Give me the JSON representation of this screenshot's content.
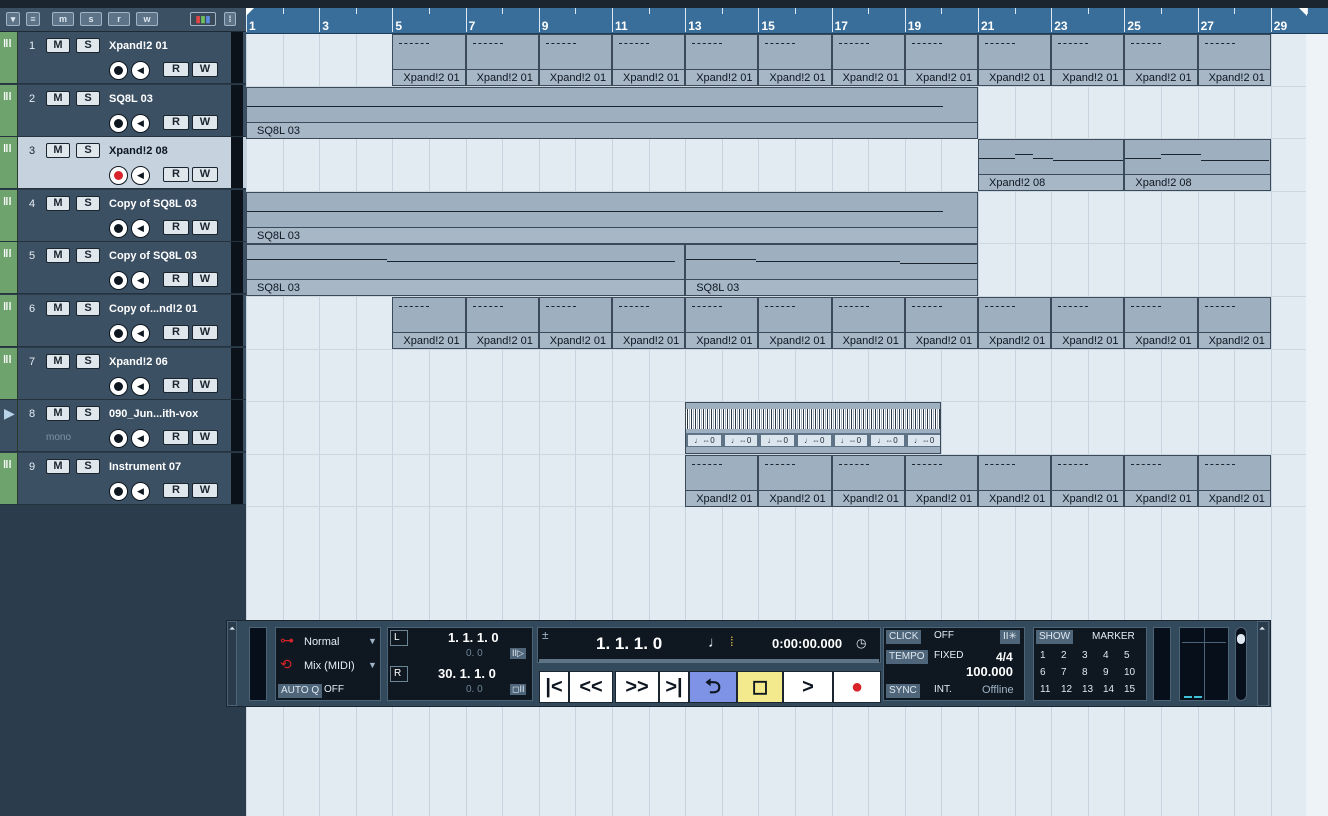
{
  "tracklist_header": {
    "buttons": [
      "m",
      "s",
      "r",
      "w"
    ]
  },
  "tracks": [
    {
      "num": "1",
      "name": "Xpand!2 01",
      "sub": "",
      "selected": false,
      "rec_on": false,
      "type": "instrument"
    },
    {
      "num": "2",
      "name": "SQ8L 03",
      "sub": "",
      "selected": false,
      "rec_on": false,
      "type": "instrument"
    },
    {
      "num": "3",
      "name": "Xpand!2 08",
      "sub": "",
      "selected": true,
      "rec_on": true,
      "type": "instrument"
    },
    {
      "num": "4",
      "name": "Copy of SQ8L 03",
      "sub": "",
      "selected": false,
      "rec_on": false,
      "type": "instrument"
    },
    {
      "num": "5",
      "name": "Copy of SQ8L 03",
      "sub": "",
      "selected": false,
      "rec_on": false,
      "type": "instrument"
    },
    {
      "num": "6",
      "name": "Copy of...nd!2 01",
      "sub": "",
      "selected": false,
      "rec_on": false,
      "type": "instrument"
    },
    {
      "num": "7",
      "name": "Xpand!2 06",
      "sub": "",
      "selected": false,
      "rec_on": false,
      "type": "instrument"
    },
    {
      "num": "8",
      "name": "090_Jun...ith-vox",
      "sub": "mono",
      "selected": false,
      "rec_on": false,
      "type": "audio"
    },
    {
      "num": "9",
      "name": "Instrument 07",
      "sub": "",
      "selected": false,
      "rec_on": false,
      "type": "instrument"
    }
  ],
  "track_buttons": {
    "mute": "M",
    "solo": "S",
    "read": "R",
    "write": "W"
  },
  "ruler": {
    "labels": [
      "1",
      "3",
      "5",
      "7",
      "9",
      "11",
      "13",
      "15",
      "17",
      "19",
      "21",
      "23",
      "25",
      "27",
      "29"
    ]
  },
  "part_labels": {
    "xpand01": "Xpand!2 01",
    "sq8l": "SQ8L 03",
    "xpand08": "Xpand!2 08",
    "audio_seg": "♩⇔0"
  },
  "transport": {
    "mode": "Normal",
    "cycle_mode": "Mix (MIDI)",
    "autoq_label": "AUTO Q",
    "autoq_value": "OFF",
    "left_locator": "1. 1. 1.   0",
    "left_locator_sub": "0.   0",
    "right_locator": "30. 1. 1.   0",
    "right_locator_sub": "0.   0",
    "position": "1. 1. 1.   0",
    "time": "0:00:00.000",
    "click_label": "CLICK",
    "click_value": "OFF",
    "tempo_label": "TEMPO",
    "tempo_mode": "FIXED",
    "signature": "4/4",
    "tempo": "100.000",
    "sync_label": "SYNC",
    "sync_mode": "INT.",
    "sync_status": "Offline",
    "show_label": "SHOW",
    "marker_label": "MARKER",
    "markers_row1": [
      "1",
      "2",
      "3",
      "4",
      "5"
    ],
    "markers_row2": [
      "6",
      "7",
      "8",
      "9",
      "10"
    ],
    "markers_row3": [
      "11",
      "12",
      "13",
      "14",
      "15"
    ]
  }
}
